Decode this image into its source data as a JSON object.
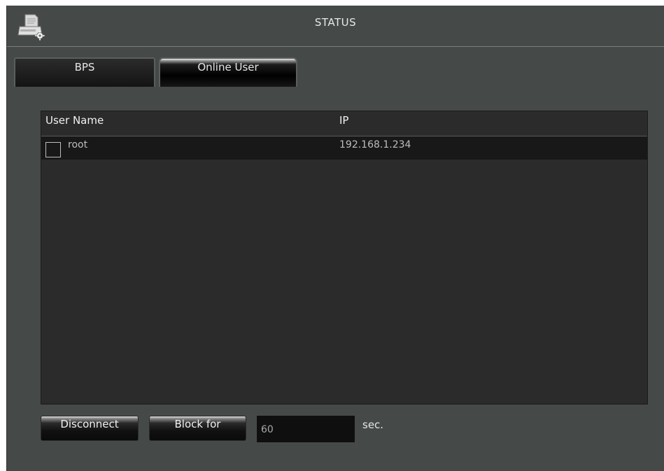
{
  "window": {
    "title": "STATUS",
    "title_icon": "printer-gear-icon"
  },
  "tabs": [
    {
      "label": "BPS",
      "active": false
    },
    {
      "label": "Online User",
      "active": true
    }
  ],
  "table": {
    "columns": [
      "User Name",
      "IP"
    ],
    "rows": [
      {
        "user": "root",
        "ip": "192.168.1.234",
        "checked": false
      }
    ]
  },
  "actions": {
    "disconnect_label": "Disconnect",
    "block_label": "Block for",
    "block_seconds": "60",
    "unit_label": "sec."
  },
  "colors": {
    "panel_bg": "#454a48",
    "grid_bg": "#2b2b2b",
    "row_bg": "#181818",
    "text": "#e6e6e6"
  }
}
